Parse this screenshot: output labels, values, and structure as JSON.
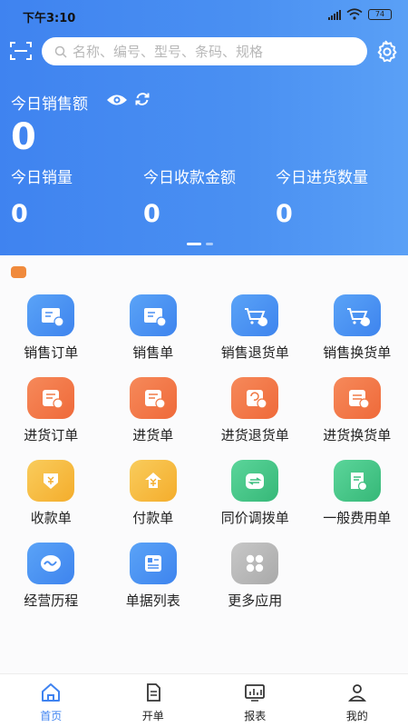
{
  "status_bar": {
    "time": "下午3:10",
    "battery": "74"
  },
  "search": {
    "placeholder": "名称、编号、型号、条码、规格"
  },
  "dashboard": {
    "sales_title": "今日销售额",
    "sales_value": "0",
    "stats": [
      {
        "label": "今日销量",
        "value": "0"
      },
      {
        "label": "今日收款金额",
        "value": "0"
      },
      {
        "label": "今日进货数量",
        "value": "0"
      }
    ]
  },
  "grid": [
    {
      "label": "销售订单",
      "color": "blue",
      "icon": "sales-order-icon"
    },
    {
      "label": "销售单",
      "color": "blue",
      "icon": "sales-bill-icon"
    },
    {
      "label": "销售退货单",
      "color": "blue",
      "icon": "sales-return-icon"
    },
    {
      "label": "销售换货单",
      "color": "blue",
      "icon": "sales-exchange-icon"
    },
    {
      "label": "进货订单",
      "color": "orange",
      "icon": "purchase-order-icon"
    },
    {
      "label": "进货单",
      "color": "orange",
      "icon": "purchase-bill-icon"
    },
    {
      "label": "进货退货单",
      "color": "orange",
      "icon": "purchase-return-icon"
    },
    {
      "label": "进货换货单",
      "color": "orange",
      "icon": "purchase-exchange-icon"
    },
    {
      "label": "收款单",
      "color": "yellow",
      "icon": "receipt-icon"
    },
    {
      "label": "付款单",
      "color": "yellow",
      "icon": "payment-icon"
    },
    {
      "label": "同价调拨单",
      "color": "green",
      "icon": "transfer-icon"
    },
    {
      "label": "一般费用单",
      "color": "green",
      "icon": "expense-icon"
    },
    {
      "label": "经营历程",
      "color": "blue",
      "icon": "history-icon"
    },
    {
      "label": "单据列表",
      "color": "blue",
      "icon": "document-list-icon"
    },
    {
      "label": "更多应用",
      "color": "gray",
      "icon": "more-apps-icon"
    }
  ],
  "tabs": [
    {
      "label": "首页",
      "icon": "home-icon"
    },
    {
      "label": "开单",
      "icon": "create-order-icon"
    },
    {
      "label": "报表",
      "icon": "report-icon"
    },
    {
      "label": "我的",
      "icon": "profile-icon"
    }
  ],
  "colors": {
    "primary": "#3f83f0",
    "orange": "#ef6a3a",
    "yellow": "#f4ad2c",
    "green": "#36b878",
    "gray": "#a9a9a9"
  }
}
